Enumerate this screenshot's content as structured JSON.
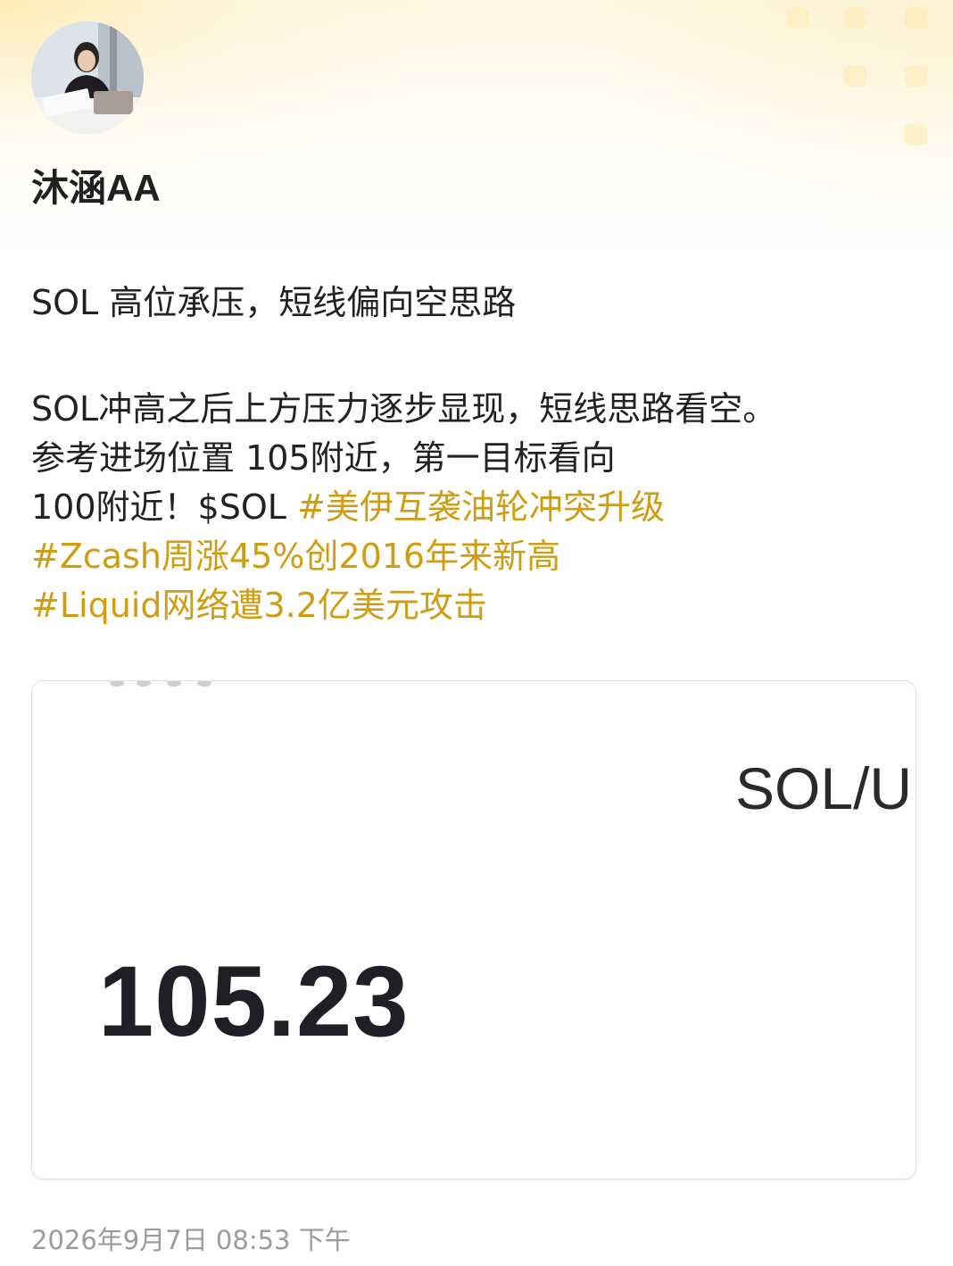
{
  "author": {
    "name": "沐涵AA",
    "avatar_icon": "profile-photo"
  },
  "post": {
    "title": "SOL 高位承压，短线偏向空思路",
    "body_line1": "SOL冲高之后上方压力逐步显现，短线思路看空。",
    "body_line2": "参考进场位置 105附近，第一目标看向",
    "body_line3_text": "100附近！",
    "cashtag": "$SOL",
    "hashtags": [
      "#美伊互袭油轮冲突升级",
      "#Zcash周涨45%创2016年来新高",
      "#Liquid网络遭3.2亿美元攻击"
    ],
    "hashtag_color": "#cf9c12"
  },
  "attachment": {
    "pair_label": "SOL/U",
    "price": "105.23"
  },
  "timestamp": "2026年9月7日 08:53 下午"
}
